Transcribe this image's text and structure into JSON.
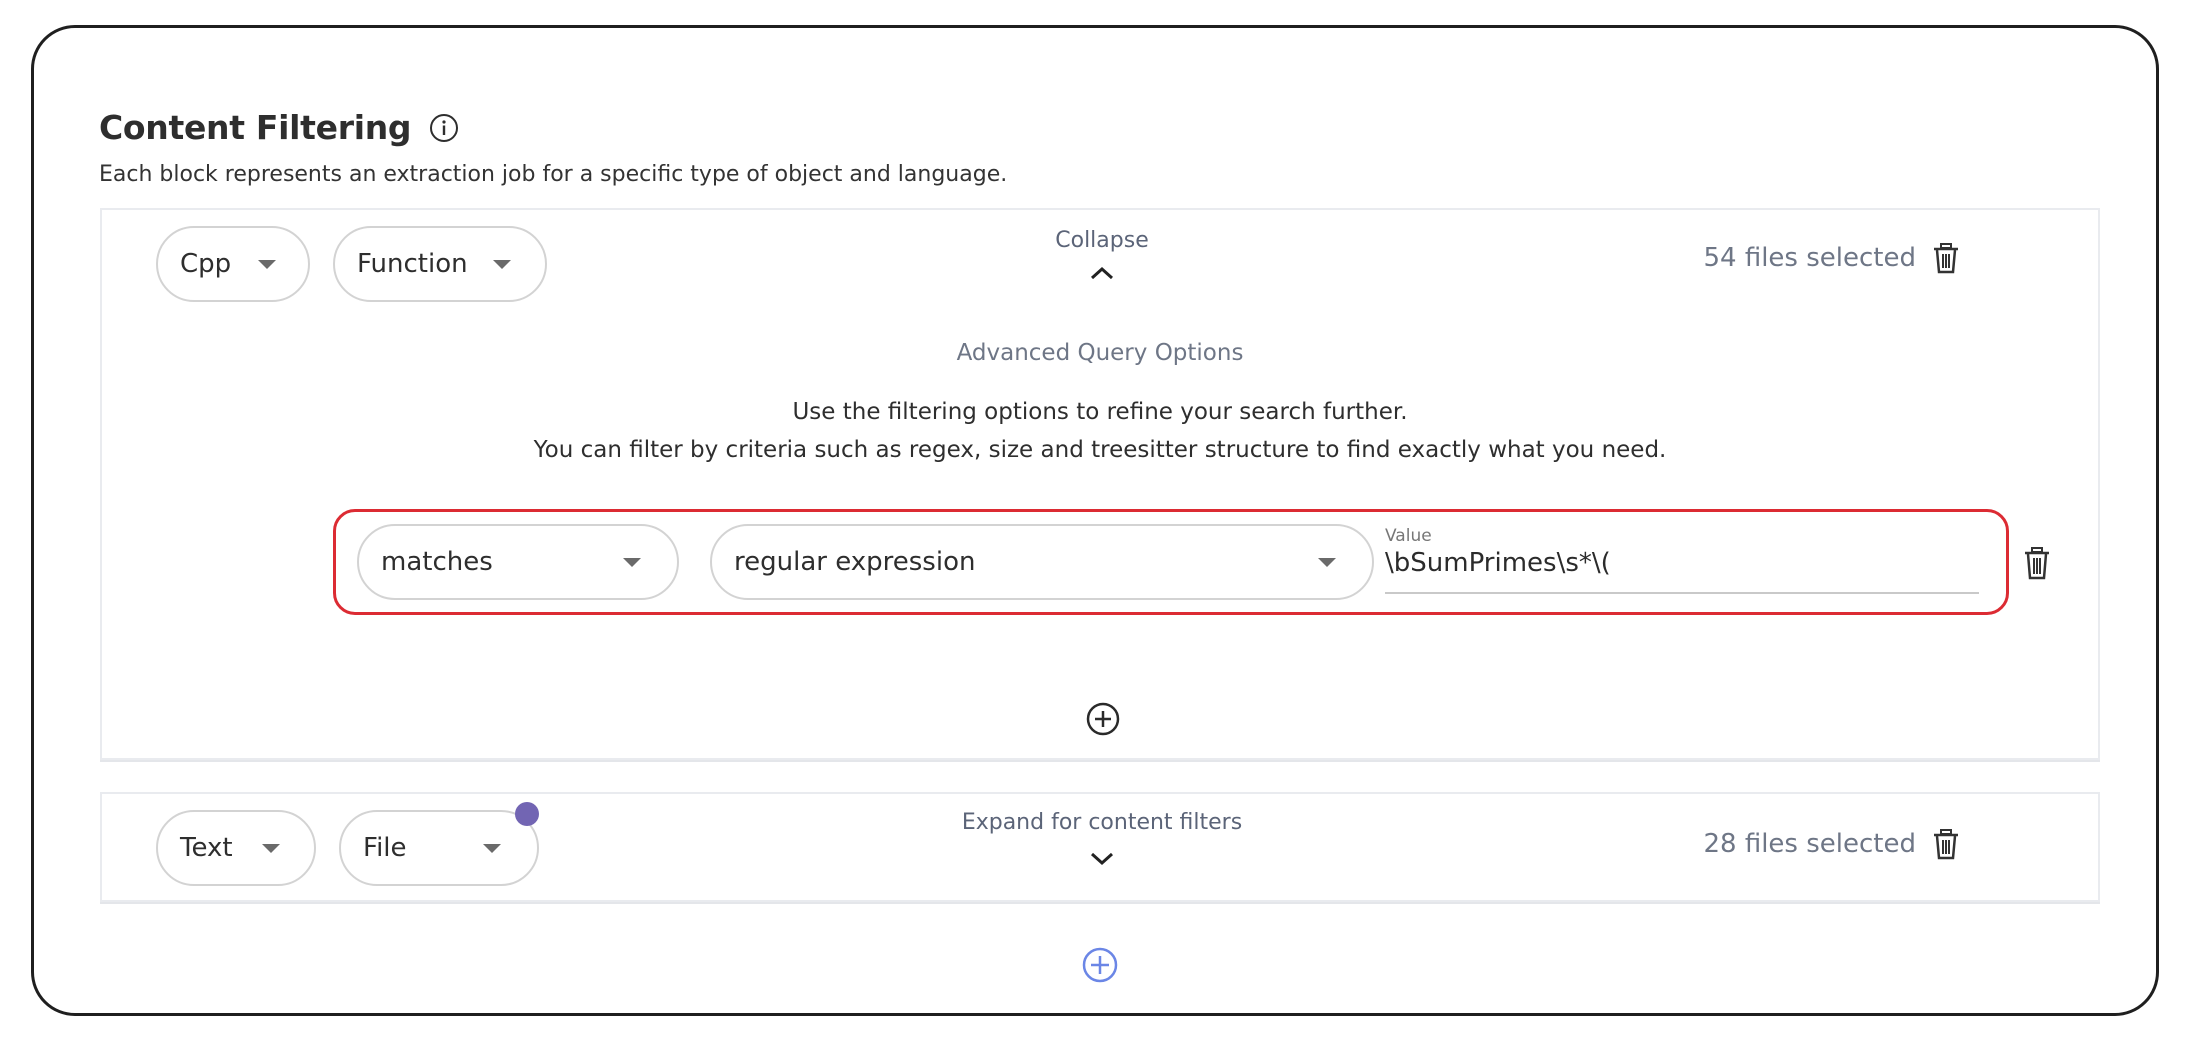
{
  "section": {
    "title": "Content Filtering",
    "info_icon": "info-circle-icon",
    "subtitle": "Each block represents an extraction job for a specific type of object and language."
  },
  "blocks": [
    {
      "language": "Cpp",
      "object_type": "Function",
      "toggle_label": "Collapse",
      "toggle_icon": "chevron-up-icon",
      "files_selected": "54 files selected",
      "expanded": true,
      "advanced": {
        "title": "Advanced Query Options",
        "description_line1": "Use the filtering options to refine your search further.",
        "description_line2": "You can filter by criteria such as regex, size and treesitter structure to find exactly what you need."
      },
      "conditions": [
        {
          "operator": "matches",
          "criterion": "regular expression",
          "value_label": "Value",
          "value": "\\bSumPrimes\\s*\\("
        }
      ],
      "highlight_color": "#dc2b33"
    },
    {
      "language": "Text",
      "object_type": "File",
      "toggle_label": "Expand for content filters",
      "toggle_icon": "chevron-down-icon",
      "files_selected": "28 files selected",
      "expanded": false,
      "badge_color": "#7265b3"
    }
  ],
  "colors": {
    "add_block_accent": "#6b86e6",
    "muted_text": "#6e7686"
  }
}
